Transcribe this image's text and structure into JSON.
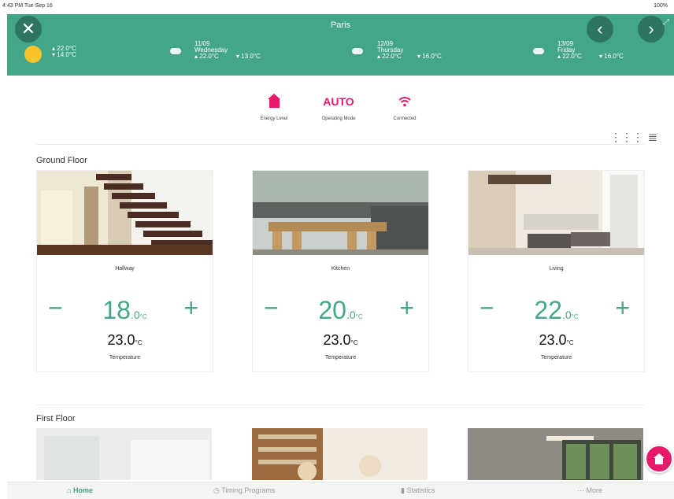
{
  "status_bar": {
    "left": "4:43 PM Tue Sep 16",
    "right": "100%"
  },
  "header": {
    "city": "Paris",
    "days": [
      {
        "icon": "sun-icon",
        "date": "",
        "weekday": "",
        "high": "22.0°C",
        "low": "14.0°C"
      },
      {
        "icon": "cloud-icon",
        "date": "11/09",
        "weekday": "Wednesday",
        "high": "22.0°C",
        "low": "13.0°C"
      },
      {
        "icon": "cloud-icon",
        "date": "12/09",
        "weekday": "Thursday",
        "high": "22.0°C",
        "low": "16.0°C"
      },
      {
        "icon": "cloud-icon",
        "date": "13/09",
        "weekday": "Friday",
        "high": "22.0°C",
        "low": "16.0°C"
      }
    ]
  },
  "status_tiles": [
    {
      "icon": "house-icon",
      "label": "Energy Level"
    },
    {
      "value": "AUTO",
      "label": "Operating Mode"
    },
    {
      "icon": "wifi-icon",
      "label": "Connected"
    }
  ],
  "sections": [
    {
      "title": "Ground Floor"
    },
    {
      "title": "First Floor"
    }
  ],
  "rooms": [
    {
      "name": "Hallway",
      "target_int": "18",
      "target_dec": ".0",
      "unit": "°C",
      "current": "23.0",
      "label": "Temperature"
    },
    {
      "name": "Kitchen",
      "target_int": "20",
      "target_dec": ".0",
      "unit": "°C",
      "current": "23.0",
      "label": "Temperature"
    },
    {
      "name": "Living",
      "target_int": "22",
      "target_dec": ".0",
      "unit": "°C",
      "current": "23.0",
      "label": "Temperature"
    }
  ],
  "tabs": [
    {
      "icon": "home-icon",
      "label": "Home"
    },
    {
      "icon": "timer-icon",
      "label": "Timing Programs"
    },
    {
      "icon": "statistics-icon",
      "label": "Statistics"
    },
    {
      "icon": "more-icon",
      "label": "More"
    }
  ],
  "colors": {
    "header": "#43a58a",
    "accent": "#e8186b",
    "temperature": "#43a58a"
  }
}
